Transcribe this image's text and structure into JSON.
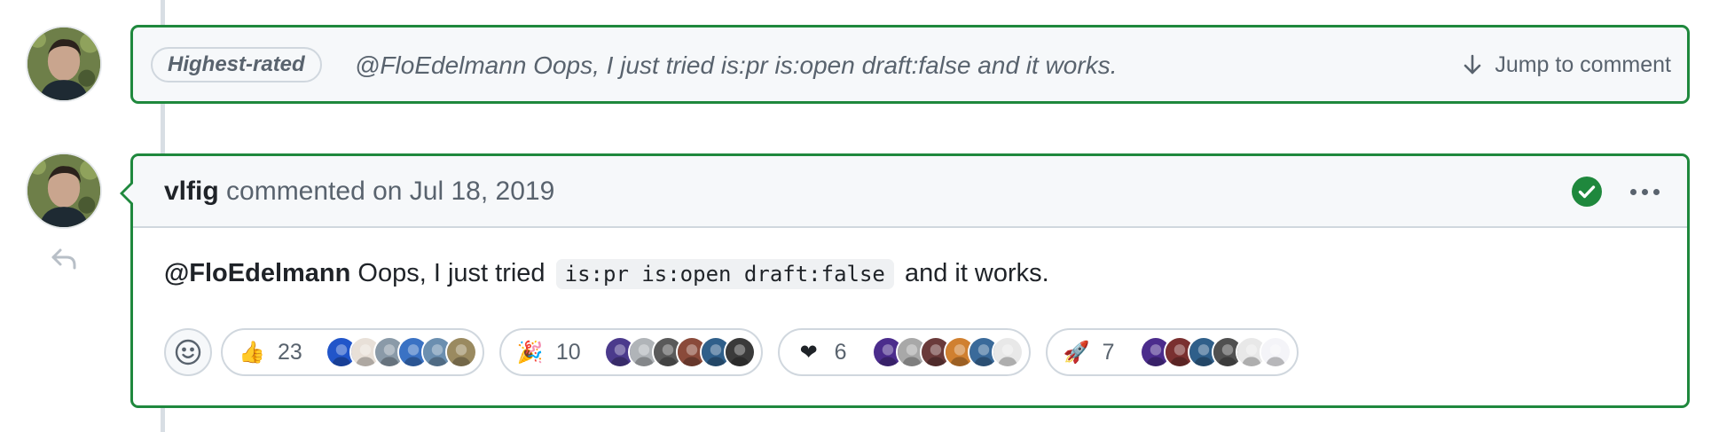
{
  "banner": {
    "badge": "Highest-rated",
    "preview": "@FloEdelmann Oops, I just tried is:pr is:open draft:false and it works.",
    "jump_label": "Jump to comment"
  },
  "comment": {
    "author": "vlfig",
    "meta": "commented on Jul 18, 2019",
    "body": {
      "mention": "@FloEdelmann",
      "before_code": "Oops, I just tried",
      "code": "is:pr is:open draft:false",
      "after_code": "and it works."
    }
  },
  "reactions": [
    {
      "emoji": "👍",
      "name": "thumbs-up",
      "count": "23",
      "faces": [
        "#2155c9",
        "#e8e0d8",
        "#8a9aa8",
        "#3a72c4",
        "#6b8fb0",
        "#9a8a60"
      ]
    },
    {
      "emoji": "🎉",
      "name": "hooray",
      "count": "10",
      "faces": [
        "#4b3a8c",
        "#b0b4b8",
        "#5a5a5a",
        "#8a4a3a",
        "#2f5f8a",
        "#3a3a3a"
      ]
    },
    {
      "emoji": "❤",
      "name": "heart",
      "count": "6",
      "faces": [
        "#4b2c8c",
        "#a8a8a8",
        "#6a3a3a",
        "#d08030",
        "#3a6a9a",
        "#e8e8e8"
      ]
    },
    {
      "emoji": "🚀",
      "name": "rocket",
      "count": "7",
      "faces": [
        "#4b2c8c",
        "#7a3030",
        "#2f5f8a",
        "#505050",
        "#e8e8e8",
        "#f4f4f8"
      ]
    }
  ],
  "colors": {
    "accent_border": "#1f883d",
    "check_green": "#1f883d",
    "header_bg": "#f6f8fa",
    "muted_text": "#59636e"
  }
}
